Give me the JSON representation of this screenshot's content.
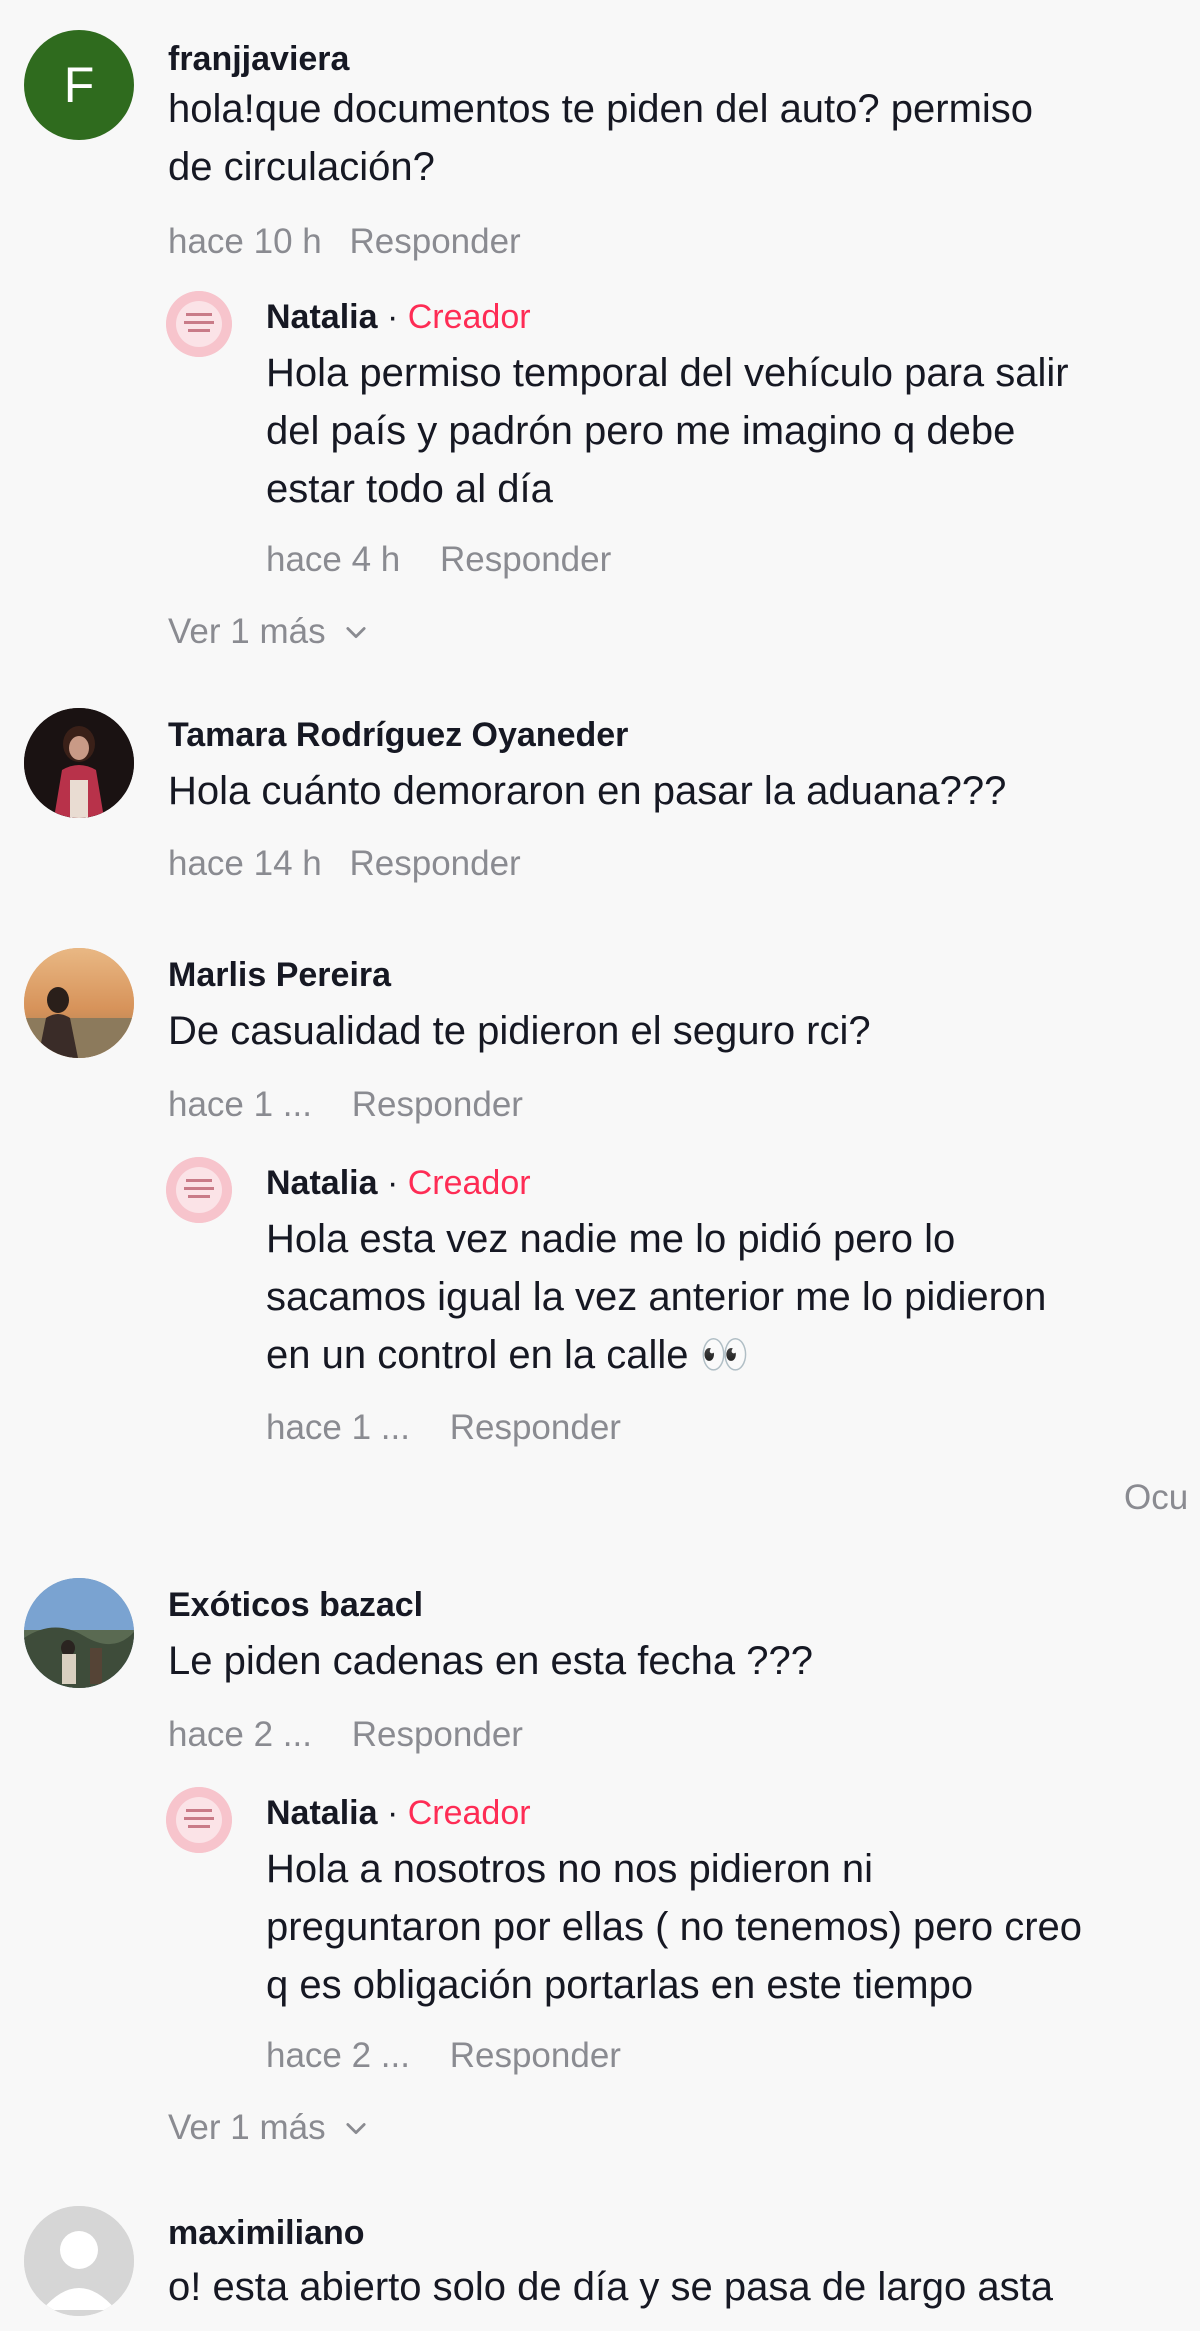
{
  "comments": [
    {
      "avatar_letter": "F",
      "avatar_color": "#2f6b1e",
      "username": "franjjaviera",
      "text_lines": [
        "hola!que documentos te piden del auto? permiso",
        "de circulación?"
      ],
      "time": "hace 10 h",
      "reply_label": "Responder",
      "reply": {
        "username": "Natalia",
        "separator": "·",
        "badge": "Creador",
        "text_lines": [
          "Hola permiso temporal del vehículo para salir",
          "del país y padrón pero me imagino q debe",
          "estar todo al día"
        ],
        "time": "hace 4 h",
        "reply_label": "Responder"
      },
      "more_label": "Ver 1 más"
    },
    {
      "username": "Tamara Rodríguez Oyaneder",
      "text_lines": [
        "Hola cuánto demoraron en pasar la aduana???"
      ],
      "time": "hace 14 h",
      "reply_label": "Responder"
    },
    {
      "username": "Marlis Pereira",
      "text_lines": [
        "De casualidad te pidieron el seguro rci?"
      ],
      "time": "hace 1 ...",
      "reply_label": "Responder",
      "reply": {
        "username": "Natalia",
        "separator": "·",
        "badge": "Creador",
        "text_lines": [
          "Hola esta vez nadie me lo pidió pero lo",
          "sacamos igual la vez anterior me lo pidieron",
          "en un control en la calle 👀"
        ],
        "time": "hace 1 ...",
        "reply_label": "Responder"
      },
      "hide_label": "Ocu"
    },
    {
      "username": "Exóticos bazacl",
      "text_lines": [
        "Le piden cadenas en esta fecha ???"
      ],
      "time": "hace 2 ...",
      "reply_label": "Responder",
      "reply": {
        "username": "Natalia",
        "separator": "·",
        "badge": "Creador",
        "text_lines": [
          "Hola a nosotros no nos pidieron ni",
          "preguntaron por ellas ( no tenemos) pero creo",
          "q es obligación portarlas en este tiempo"
        ],
        "time": "hace 2 ...",
        "reply_label": "Responder"
      },
      "more_label": "Ver 1 más"
    },
    {
      "username": "maximiliano",
      "text_lines": [
        "o! esta abierto solo de día y se pasa de largo asta"
      ]
    }
  ],
  "colors": {
    "background": "#f8f8f8",
    "text": "#161823",
    "meta": "#8a8b91",
    "creator": "#fe2c55"
  }
}
